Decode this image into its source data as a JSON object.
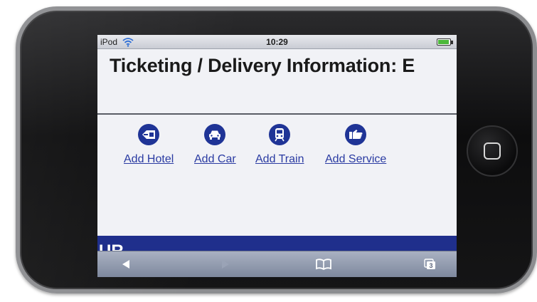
{
  "status_bar": {
    "carrier": "iPod",
    "time": "10:29",
    "wifi_icon": "wifi-icon",
    "battery_icon": "battery-icon",
    "battery_level": 0.85,
    "battery_color": "#4bb83a"
  },
  "page": {
    "title": "Ticketing / Delivery Information: E",
    "band_text": "UR",
    "band_color": "#1f2f8c"
  },
  "actions": [
    {
      "label": "Add Hotel",
      "icon": "hotel-icon"
    },
    {
      "label": "Add Car",
      "icon": "car-icon"
    },
    {
      "label": "Add Train",
      "icon": "train-icon"
    },
    {
      "label": "Add Service",
      "icon": "service-icon"
    }
  ],
  "toolbar": {
    "back_icon": "back-arrow-icon",
    "forward_icon": "forward-arrow-icon",
    "bookmarks_icon": "bookmarks-book-icon",
    "pages_icon": "pages-icon",
    "pages_count": "3"
  },
  "colors": {
    "link": "#2a3ba2",
    "icon_circle": "#1f3496"
  }
}
